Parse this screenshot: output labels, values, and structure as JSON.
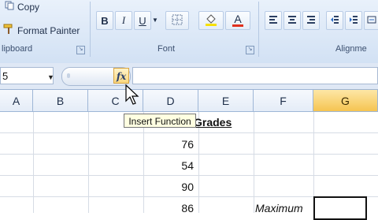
{
  "ribbon": {
    "clipboard": {
      "copy_label": "Copy",
      "format_painter_label": "Format Painter",
      "group_label": "lipboard"
    },
    "font": {
      "bold": "B",
      "italic": "I",
      "underline": "U",
      "font_color_glyph": "A",
      "group_label": "Font",
      "font_color_bar": "#e0301e",
      "highlight_bar": "#f6e000"
    },
    "alignment": {
      "group_label": "Alignme"
    }
  },
  "formula_bar": {
    "name_box_value": "5",
    "fx_label": "fx",
    "formula_value": ""
  },
  "tooltip": {
    "text": "Insert Function"
  },
  "columns": [
    "A",
    "B",
    "C",
    "D",
    "E",
    "F",
    "G"
  ],
  "active_column": "G",
  "cells": {
    "header_text": "Grades",
    "values": [
      "76",
      "54",
      "90",
      "86"
    ],
    "label_text": "Maximum"
  }
}
